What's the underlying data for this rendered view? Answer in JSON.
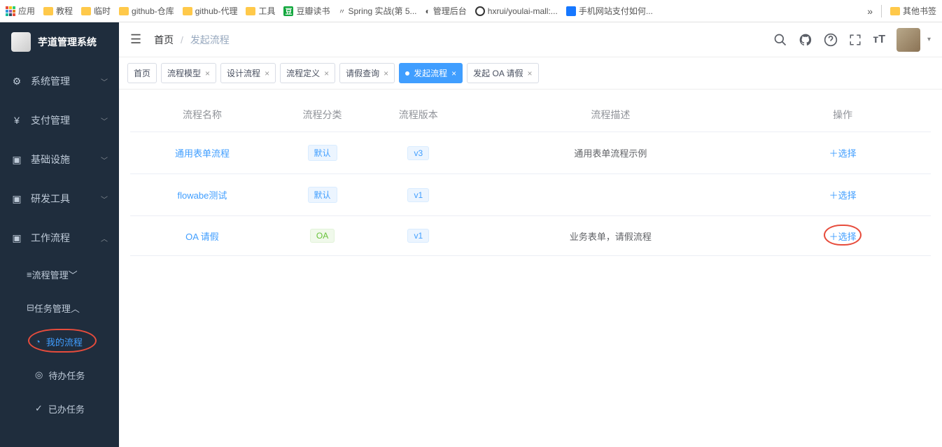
{
  "bookmarks": {
    "apps": "应用",
    "items": [
      "教程",
      "临时",
      "github-仓库",
      "github-代理",
      "工具"
    ],
    "douban": "豆瓣读书",
    "spring": "Spring 实战(第 5...",
    "admin": "管理后台",
    "gh": "hxrui/youlai-mall:...",
    "alipay": "手机网站支付如何...",
    "more": "»",
    "other": "其他书签"
  },
  "brand": "芋道管理系统",
  "sidebar": {
    "items": [
      {
        "icon": "⚙",
        "label": "系统管理",
        "arrow": "﹀"
      },
      {
        "icon": "¥",
        "label": "支付管理",
        "arrow": "﹀"
      },
      {
        "icon": "▣",
        "label": "基础设施",
        "arrow": "﹀"
      },
      {
        "icon": "▣",
        "label": "研发工具",
        "arrow": "﹀"
      },
      {
        "icon": "▣",
        "label": "工作流程",
        "arrow": "︿"
      }
    ],
    "sub": [
      {
        "icon": "≡",
        "label": "流程管理",
        "arrow": "﹀"
      },
      {
        "icon": "⊟",
        "label": "任务管理",
        "arrow": "︿"
      }
    ],
    "subsub": [
      {
        "icon": "◔",
        "label": "我的流程"
      },
      {
        "icon": "◎",
        "label": "待办任务"
      },
      {
        "icon": "✓",
        "label": "已办任务"
      }
    ]
  },
  "breadcrumb": {
    "home": "首页",
    "current": "发起流程"
  },
  "tabs": [
    {
      "label": "首页",
      "close": false
    },
    {
      "label": "流程模型",
      "close": true
    },
    {
      "label": "设计流程",
      "close": true
    },
    {
      "label": "流程定义",
      "close": true
    },
    {
      "label": "请假查询",
      "close": true
    },
    {
      "label": "发起流程",
      "close": true,
      "active": true
    },
    {
      "label": "发起 OA 请假",
      "close": true
    }
  ],
  "table": {
    "headers": [
      "流程名称",
      "流程分类",
      "流程版本",
      "流程描述",
      "操作"
    ],
    "rows": [
      {
        "name": "通用表单流程",
        "cat": "默认",
        "catClass": "b",
        "ver": "v3",
        "desc": "通用表单流程示例",
        "op": "＋选择"
      },
      {
        "name": "flowabe测试",
        "cat": "默认",
        "catClass": "b",
        "ver": "v1",
        "desc": "",
        "op": "＋选择"
      },
      {
        "name": "OA 请假",
        "cat": "OA",
        "catClass": "g",
        "ver": "v1",
        "desc": "业务表单，请假流程",
        "op": "＋选择",
        "circled": true
      }
    ]
  }
}
